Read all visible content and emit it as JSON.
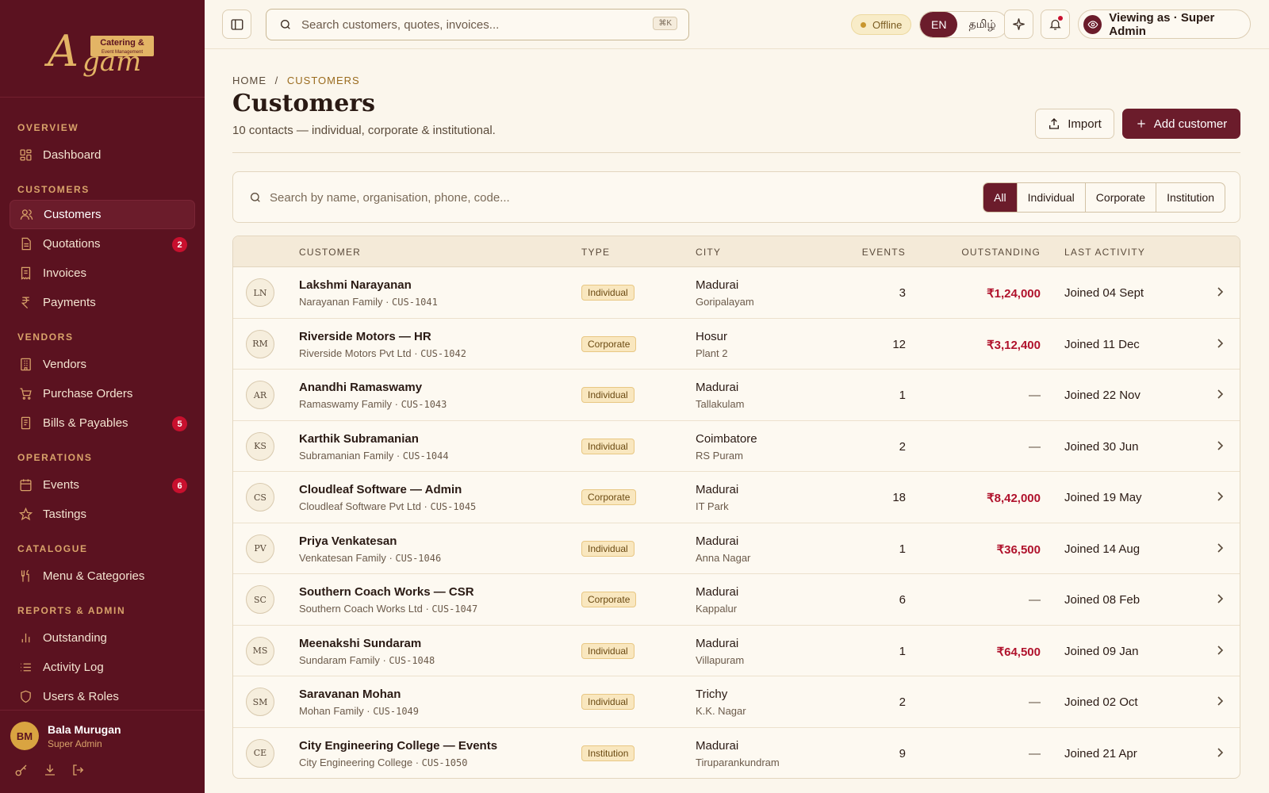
{
  "brand": {
    "logo_script": "Agam",
    "logo_tag1": "Catering &",
    "logo_tag2": "Event Management"
  },
  "sidebar": {
    "sections": [
      {
        "title": "OVERVIEW",
        "items": [
          {
            "label": "Dashboard",
            "icon": "dashboard-icon"
          }
        ]
      },
      {
        "title": "CUSTOMERS",
        "items": [
          {
            "label": "Customers",
            "icon": "users-icon",
            "active": true
          },
          {
            "label": "Quotations",
            "icon": "document-icon",
            "badge": "2"
          },
          {
            "label": "Invoices",
            "icon": "receipt-icon"
          },
          {
            "label": "Payments",
            "icon": "rupee-icon"
          }
        ]
      },
      {
        "title": "VENDORS",
        "items": [
          {
            "label": "Vendors",
            "icon": "building-icon"
          },
          {
            "label": "Purchase Orders",
            "icon": "cart-icon"
          },
          {
            "label": "Bills & Payables",
            "icon": "bill-icon",
            "badge": "5"
          }
        ]
      },
      {
        "title": "OPERATIONS",
        "items": [
          {
            "label": "Events",
            "icon": "calendar-icon",
            "badge": "6"
          },
          {
            "label": "Tastings",
            "icon": "star-icon"
          }
        ]
      },
      {
        "title": "CATALOGUE",
        "items": [
          {
            "label": "Menu & Categories",
            "icon": "utensils-icon"
          }
        ]
      },
      {
        "title": "REPORTS & ADMIN",
        "items": [
          {
            "label": "Outstanding",
            "icon": "bar-chart-icon"
          },
          {
            "label": "Activity Log",
            "icon": "list-icon"
          },
          {
            "label": "Users & Roles",
            "icon": "shield-icon"
          }
        ]
      }
    ],
    "user": {
      "initials": "BM",
      "name": "Bala Murugan",
      "role": "Super Admin"
    }
  },
  "topbar": {
    "search_placeholder": "Search customers, quotes, invoices...",
    "shortcut": "⌘K",
    "status": "Offline",
    "lang_en": "EN",
    "lang_ta": "தமிழ்",
    "viewing_as": "Viewing as · Super Admin"
  },
  "page": {
    "breadcrumb_home": "HOME",
    "breadcrumb_sep": "/",
    "breadcrumb_current": "CUSTOMERS",
    "title": "Customers",
    "subtitle": "10 contacts — individual, corporate & institutional.",
    "import_label": "Import",
    "add_label": "Add customer"
  },
  "filter": {
    "placeholder": "Search by name, organisation, phone, code...",
    "segments": [
      "All",
      "Individual",
      "Corporate",
      "Institution"
    ],
    "active_segment": "All"
  },
  "table": {
    "columns": {
      "customer": "CUSTOMER",
      "type": "TYPE",
      "city": "CITY",
      "events": "EVENTS",
      "outstanding": "OUTSTANDING",
      "last_activity": "LAST ACTIVITY"
    },
    "rows": [
      {
        "initials": "LN",
        "name": "Lakshmi Narayanan",
        "org": "Narayanan Family · ",
        "code": "CUS-1041",
        "type": "Individual",
        "city": "Madurai",
        "area": "Goripalayam",
        "events": "3",
        "outstanding": "₹1,24,000",
        "last": "Joined 04 Sept"
      },
      {
        "initials": "RM",
        "name": "Riverside Motors — HR",
        "org": "Riverside Motors Pvt Ltd · ",
        "code": "CUS-1042",
        "type": "Corporate",
        "city": "Hosur",
        "area": "Plant 2",
        "events": "12",
        "outstanding": "₹3,12,400",
        "last": "Joined 11 Dec"
      },
      {
        "initials": "AR",
        "name": "Anandhi Ramaswamy",
        "org": "Ramaswamy Family · ",
        "code": "CUS-1043",
        "type": "Individual",
        "city": "Madurai",
        "area": "Tallakulam",
        "events": "1",
        "outstanding": "—",
        "last": "Joined 22 Nov"
      },
      {
        "initials": "KS",
        "name": "Karthik Subramanian",
        "org": "Subramanian Family · ",
        "code": "CUS-1044",
        "type": "Individual",
        "city": "Coimbatore",
        "area": "RS Puram",
        "events": "2",
        "outstanding": "—",
        "last": "Joined 30 Jun"
      },
      {
        "initials": "CS",
        "name": "Cloudleaf Software — Admin",
        "org": "Cloudleaf Software Pvt Ltd · ",
        "code": "CUS-1045",
        "type": "Corporate",
        "city": "Madurai",
        "area": "IT Park",
        "events": "18",
        "outstanding": "₹8,42,000",
        "last": "Joined 19 May"
      },
      {
        "initials": "PV",
        "name": "Priya Venkatesan",
        "org": "Venkatesan Family · ",
        "code": "CUS-1046",
        "type": "Individual",
        "city": "Madurai",
        "area": "Anna Nagar",
        "events": "1",
        "outstanding": "₹36,500",
        "last": "Joined 14 Aug"
      },
      {
        "initials": "SC",
        "name": "Southern Coach Works — CSR",
        "org": "Southern Coach Works Ltd · ",
        "code": "CUS-1047",
        "type": "Corporate",
        "city": "Madurai",
        "area": "Kappalur",
        "events": "6",
        "outstanding": "—",
        "last": "Joined 08 Feb"
      },
      {
        "initials": "MS",
        "name": "Meenakshi Sundaram",
        "org": "Sundaram Family · ",
        "code": "CUS-1048",
        "type": "Individual",
        "city": "Madurai",
        "area": "Villapuram",
        "events": "1",
        "outstanding": "₹64,500",
        "last": "Joined 09 Jan"
      },
      {
        "initials": "SM",
        "name": "Saravanan Mohan",
        "org": "Mohan Family · ",
        "code": "CUS-1049",
        "type": "Individual",
        "city": "Trichy",
        "area": "K.K. Nagar",
        "events": "2",
        "outstanding": "—",
        "last": "Joined 02 Oct"
      },
      {
        "initials": "CE",
        "name": "City Engineering College — Events",
        "org": "City Engineering College · ",
        "code": "CUS-1050",
        "type": "Institution",
        "city": "Madurai",
        "area": "Tiruparankundram",
        "events": "9",
        "outstanding": "—",
        "last": "Joined 21 Apr"
      }
    ]
  },
  "colors": {
    "sidebar": "#5b1220",
    "accent": "#6b1c2b",
    "gold": "#d9a36a",
    "amount": "#b0122c",
    "background": "#fbf6ec"
  }
}
